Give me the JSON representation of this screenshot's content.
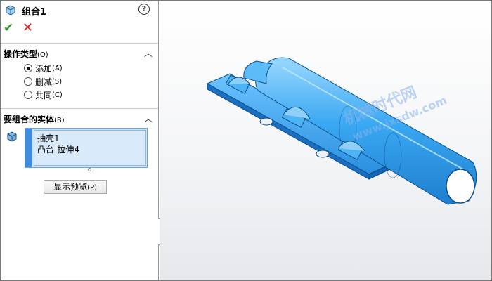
{
  "panel": {
    "title": "组合1",
    "help_glyph": "?",
    "ok_glyph": "✔",
    "cancel_glyph": "✕",
    "op_section": {
      "title": "操作类型",
      "hotkey": "(O)",
      "options": [
        {
          "label": "添加",
          "hotkey": "(A)",
          "selected": true
        },
        {
          "label": "删减",
          "hotkey": "(S)",
          "selected": false
        },
        {
          "label": "共同",
          "hotkey": "(C)",
          "selected": false
        }
      ]
    },
    "bodies_section": {
      "title": "要组合的实体",
      "hotkey": "(B)",
      "items": [
        "抽壳1",
        "凸台-拉伸4"
      ]
    },
    "preview_button": {
      "label": "显示预览",
      "hotkey": "(P)"
    }
  },
  "viewport": {
    "watermark_main": "机械时代网",
    "watermark_sub": "www.jxsdw.com",
    "model_color": "#3aa8f2"
  },
  "icons": {
    "feature": "combine-feature-icon",
    "help": "help-icon",
    "ok": "checkmark-icon",
    "cancel": "close-icon",
    "collapse": "chevron-up-icon",
    "body": "solid-body-icon"
  }
}
